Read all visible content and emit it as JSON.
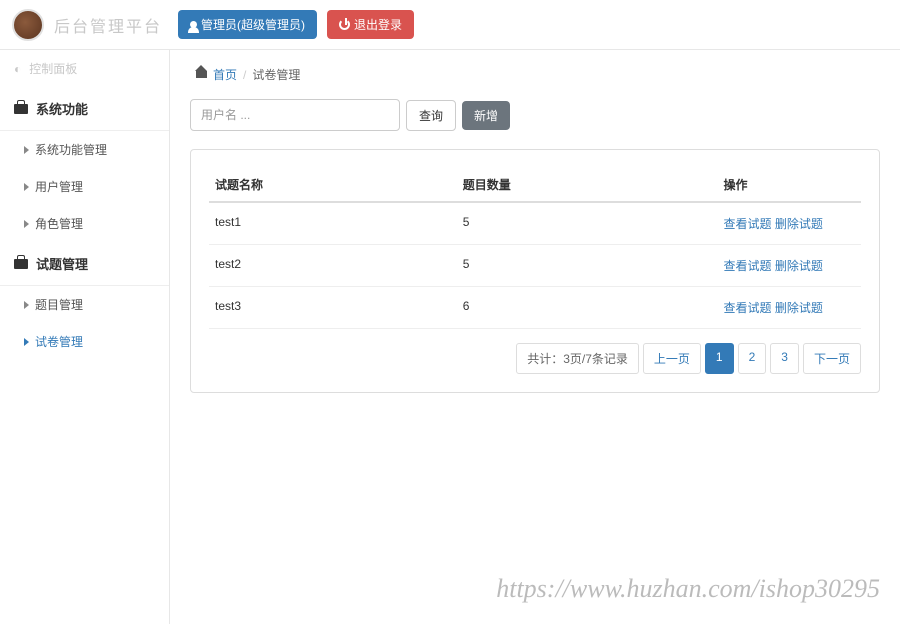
{
  "header": {
    "brand": "后台管理平台",
    "admin_button": "管理员(超级管理员)",
    "logout_button": "退出登录"
  },
  "sidebar": {
    "first_item": "控制面板",
    "section1": "系统功能",
    "section1_items": [
      "系统功能管理",
      "用户管理",
      "角色管理"
    ],
    "section2": "试题管理",
    "section2_items": [
      "题目管理",
      "试卷管理"
    ]
  },
  "breadcrumb": {
    "home": "首页",
    "current": "试卷管理"
  },
  "filter": {
    "placeholder": "用户名 ...",
    "search_label": "查询",
    "add_label": "新增"
  },
  "table": {
    "headers": {
      "name": "试题名称",
      "count": "题目数量",
      "action": "操作"
    },
    "action_view": "查看试题",
    "action_del": "删除试题",
    "rows": [
      {
        "name": "test1",
        "count": "5"
      },
      {
        "name": "test2",
        "count": "5"
      },
      {
        "name": "test3",
        "count": "6"
      }
    ]
  },
  "pager": {
    "summary": "共计：3页/7条记录",
    "prev": "上一页",
    "next": "下一页",
    "pages": [
      "1",
      "2",
      "3"
    ],
    "active": "1"
  },
  "watermark": "https://www.huzhan.com/ishop30295"
}
